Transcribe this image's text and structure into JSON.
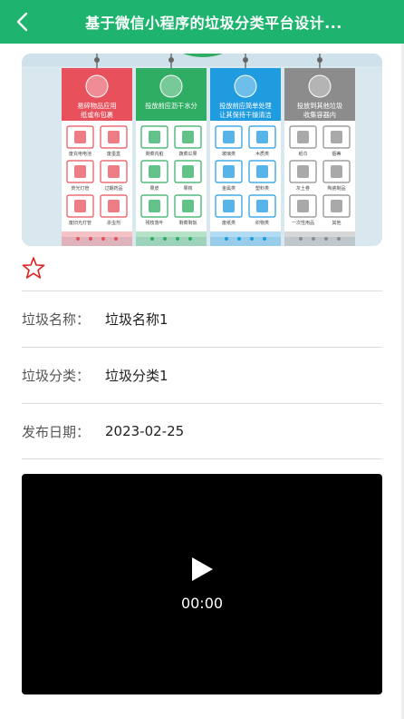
{
  "navbar": {
    "title": "基于微信小程序的垃圾分类平台设计...",
    "back_icon": "chevron-left-icon",
    "background": "#1eb46f"
  },
  "banner": {
    "bins": [
      {
        "header": [
          "易碎物品应用",
          "纸或布包裹"
        ],
        "color": "#e8505b",
        "items": [
          "废充电电池",
          "废墨盒",
          "荧光灯管",
          "过期药品",
          "废旧光灯管",
          "杀虫剂"
        ]
      },
      {
        "header": [
          "投放前应沥干水分"
        ],
        "color": "#2fad62",
        "items": [
          "剩菜内脏",
          "蔬菜瓜果",
          "果皮",
          "果核",
          "残枝落叶",
          "剩菜剩饭"
        ]
      },
      {
        "header": [
          "投放前应简单处理",
          "让其保持干燥清洁"
        ],
        "color": "#1f9be0",
        "items": [
          "玻璃类",
          "木质类",
          "金属类",
          "塑料类",
          "废纸类",
          "织物类"
        ]
      },
      {
        "header": [
          "投放到其他垃圾",
          "收集容器内"
        ],
        "color": "#8c8c8c",
        "items": [
          "纸巾",
          "烟蒂",
          "灰土卷",
          "陶瓷制品",
          "一次性用品",
          "其他"
        ]
      }
    ]
  },
  "favorite": {
    "icon": "star-outline-icon",
    "color": "#e02020"
  },
  "details": {
    "name_label": "垃圾名称：",
    "name_value": "垃圾名称1",
    "category_label": "垃圾分类：",
    "category_value": "垃圾分类1",
    "date_label": "发布日期：",
    "date_value": "2023-02-25"
  },
  "video": {
    "play_icon": "play-icon",
    "time": "00:00"
  }
}
